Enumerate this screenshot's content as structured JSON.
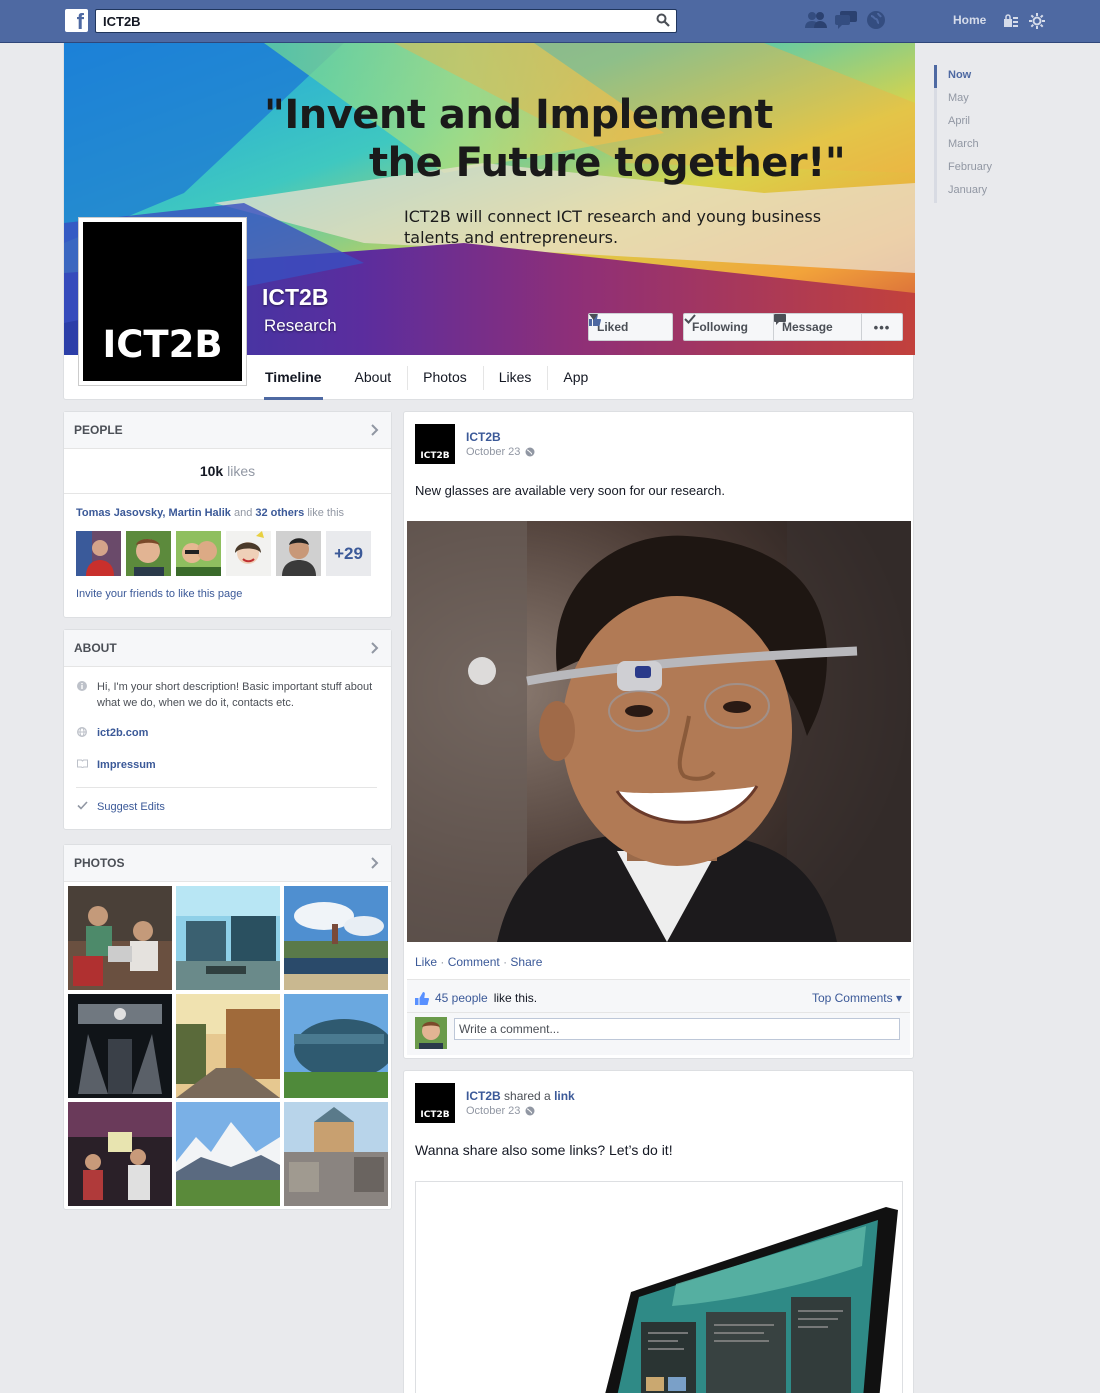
{
  "topbar": {
    "search_value": "ICT2B",
    "home_label": "Home",
    "accent": "#4e69a2"
  },
  "scrubber": [
    "Now",
    "May",
    "April",
    "March",
    "February",
    "January"
  ],
  "cover": {
    "quote_line1": "\"Invent and Implement",
    "quote_line2": "the Future together!\"",
    "subtitle": "ICT2B will connect ICT research and young business talents and entrepreneurs.",
    "page_name": "ICT2B",
    "page_category": "Research",
    "profile_text": "ICT2B",
    "buttons": {
      "liked": "Liked",
      "following": "Following",
      "message": "Message",
      "more": "•••"
    }
  },
  "tabs": [
    "Timeline",
    "About",
    "Photos",
    "Likes",
    "App"
  ],
  "people": {
    "title": "PEOPLE",
    "likes_number": "10k",
    "likes_word": "likes",
    "friend_names": "Tomas Jasovsky, Martin Halik",
    "and": "and",
    "others": "32 others",
    "like_this": "like this",
    "plus_count": "+29",
    "invite": "Invite your friends to like this page"
  },
  "about": {
    "title": "ABOUT",
    "description": "Hi, I'm your short description! Basic important stuff about what we do, when we do it, contacts etc.",
    "website": "ict2b.com",
    "impressum": "Impressum",
    "suggest": "Suggest Edits"
  },
  "photos": {
    "title": "PHOTOS"
  },
  "posts": [
    {
      "author": "ICT2B",
      "date": "October 23",
      "text": "New glasses are available very soon for our research.",
      "actions": {
        "like": "Like",
        "comment": "Comment",
        "share": "Share"
      },
      "people_count": "45 people",
      "like_this": "like this.",
      "top_comments": "Top Comments ▾",
      "comment_placeholder": "Write a comment..."
    },
    {
      "author": "ICT2B",
      "shared": "shared a",
      "link_word": "link",
      "date": "October 23",
      "text": "Wanna share also some links? Let’s do it!"
    }
  ]
}
